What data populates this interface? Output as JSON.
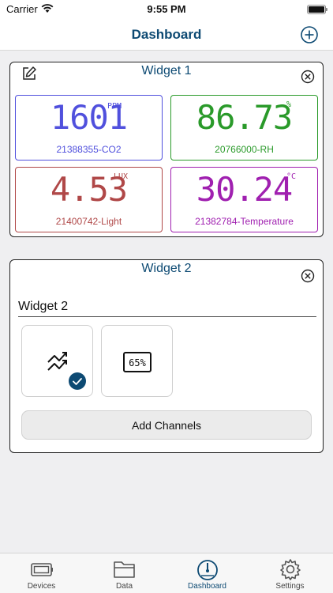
{
  "status_bar": {
    "carrier": "Carrier",
    "time": "9:55 PM"
  },
  "header": {
    "title": "Dashboard",
    "add_icon": "plus-circle-icon"
  },
  "colors": {
    "brand": "#0d4a73",
    "co2": "#5050dd",
    "rh": "#2a9a2a",
    "light": "#b04848",
    "temp": "#a020b0"
  },
  "widget1": {
    "title": "Widget 1",
    "tiles": [
      {
        "value": "1601",
        "unit": "PPM",
        "label": "21388355-CO2"
      },
      {
        "value": "86.73",
        "unit": "%",
        "label": "20766000-RH"
      },
      {
        "value": "4.53",
        "unit": "LUX",
        "label": "21400742-Light"
      },
      {
        "value": "30.24",
        "unit": "°C",
        "label": "21382784-Temperature"
      }
    ]
  },
  "widget2": {
    "title": "Widget 2",
    "name_value": "Widget 2",
    "options": [
      {
        "icon": "chart-line-icon",
        "selected": true
      },
      {
        "icon": "percent-display-icon",
        "selected": false,
        "text": "65%"
      }
    ],
    "add_channels_label": "Add Channels"
  },
  "tabs": [
    {
      "label": "Devices",
      "icon": "device-icon",
      "active": false
    },
    {
      "label": "Data",
      "icon": "folder-icon",
      "active": false
    },
    {
      "label": "Dashboard",
      "icon": "gauge-icon",
      "active": true
    },
    {
      "label": "Settings",
      "icon": "gear-icon",
      "active": false
    }
  ]
}
